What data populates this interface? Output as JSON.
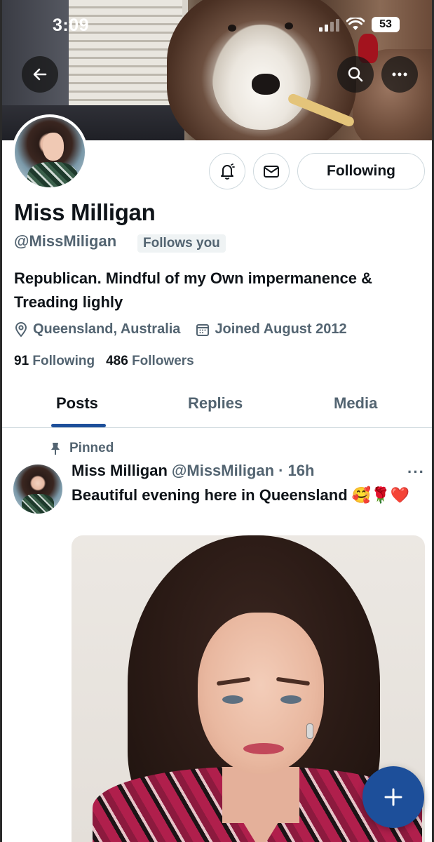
{
  "status_bar": {
    "time": "3:09",
    "battery": "53"
  },
  "profile": {
    "name": "Miss Milligan",
    "handle": "@MissMiligan",
    "follows_you": "Follows you",
    "bio": "Republican. Mindful of my Own impermanence & Treading lighly",
    "location": "Queensland, Australia",
    "joined": "Joined August 2012",
    "following_count": "91",
    "following_label": "Following",
    "followers_count": "486",
    "followers_label": "Followers",
    "follow_button": "Following"
  },
  "tabs": [
    {
      "label": "Posts",
      "active": true
    },
    {
      "label": "Replies",
      "active": false
    },
    {
      "label": "Media",
      "active": false
    }
  ],
  "post": {
    "pinned_label": "Pinned",
    "author_name": "Miss Milligan",
    "author_handle": "@MissMiligan",
    "time": "· 16h",
    "text": "Beautiful evening here in Queensland 🥰🌹❤️",
    "more": "···"
  },
  "icons": {
    "back": "back-arrow-icon",
    "search": "search-icon",
    "more": "more-icon",
    "notify": "bell-icon",
    "message": "envelope-icon",
    "location": "location-pin-icon",
    "calendar": "calendar-icon",
    "pin": "pin-icon",
    "compose": "plus-icon"
  },
  "colors": {
    "accent": "#1d4f9a",
    "text": "#0f1419",
    "muted": "#536471",
    "border": "#cfd9de"
  }
}
